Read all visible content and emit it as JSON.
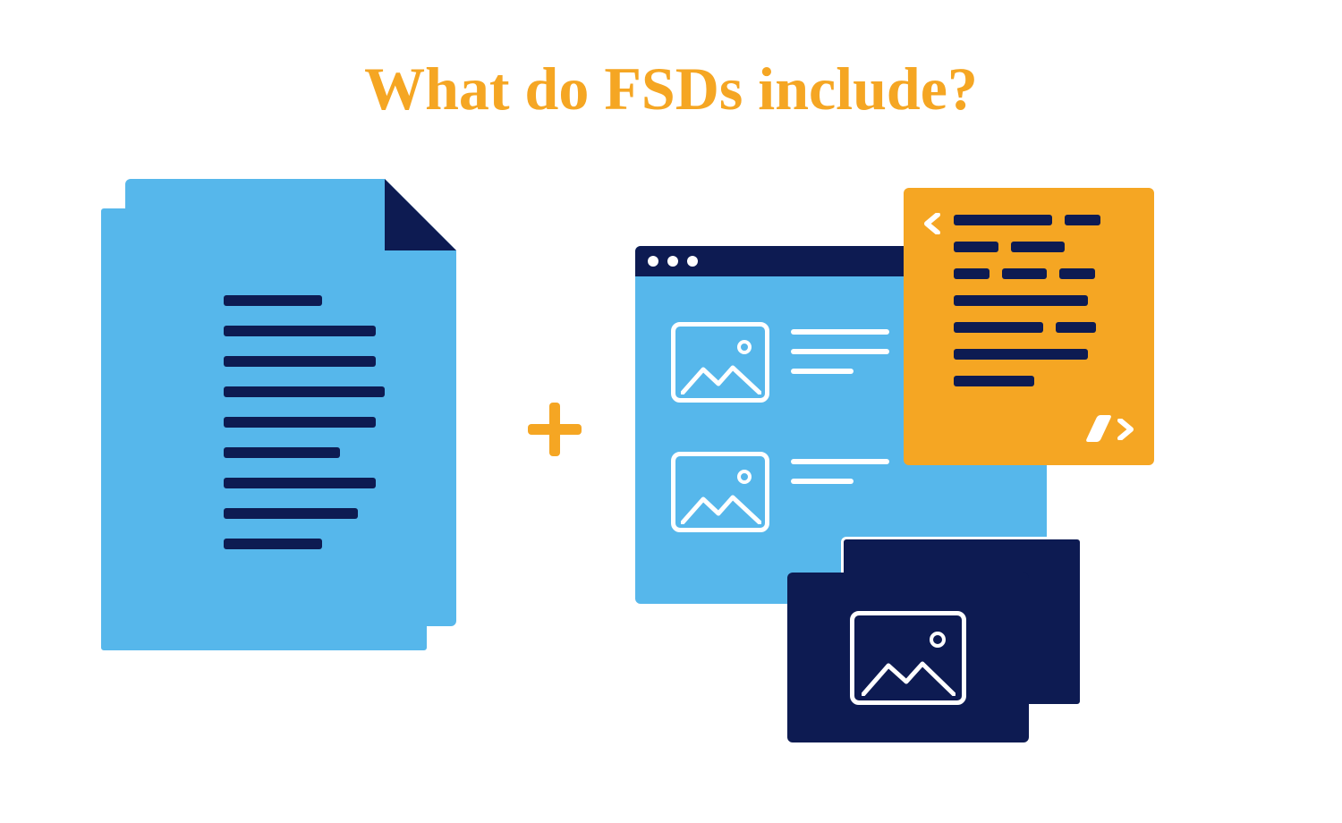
{
  "title": "What do FSDs include?",
  "colors": {
    "accent_orange": "#f5a623",
    "navy": "#0d1b52",
    "sky": "#56b7eb",
    "white": "#ffffff"
  },
  "icons": {
    "left": "document-stack-icon",
    "connector": "plus-icon",
    "right_browser": "browser-window-icon",
    "right_code": "code-snippet-icon",
    "right_image": "image-stack-icon"
  }
}
